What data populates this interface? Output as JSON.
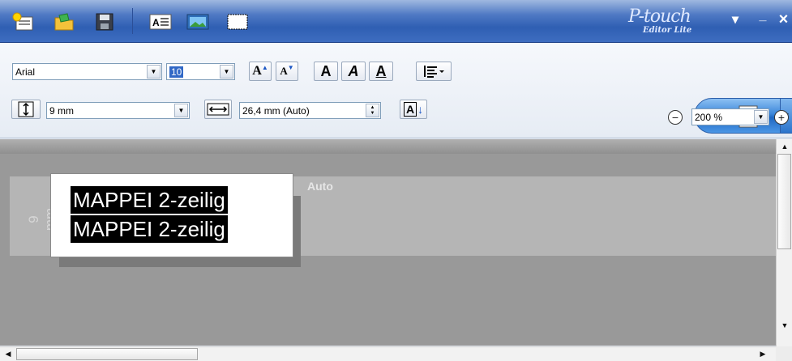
{
  "brand": {
    "line1": "P-touch",
    "line2": "Editor Lite"
  },
  "window_controls": {
    "menu": "▾",
    "minimize": "_",
    "close": "×"
  },
  "font": {
    "name": "Arial",
    "size": "10"
  },
  "text_format": {
    "grow": "A",
    "shrink": "A",
    "bold": "A",
    "italic": "A",
    "underline": "A",
    "vertical": "A"
  },
  "tape": {
    "width": "9 mm",
    "length": "26,4 mm (Auto)"
  },
  "zoom": {
    "value": "200 %",
    "out": "−",
    "in": "+"
  },
  "canvas": {
    "side_label": "9 mm",
    "auto_label": "Auto",
    "lines": [
      "MAPPEI 2-zeilig",
      "MAPPEI 2-zeilig"
    ]
  }
}
